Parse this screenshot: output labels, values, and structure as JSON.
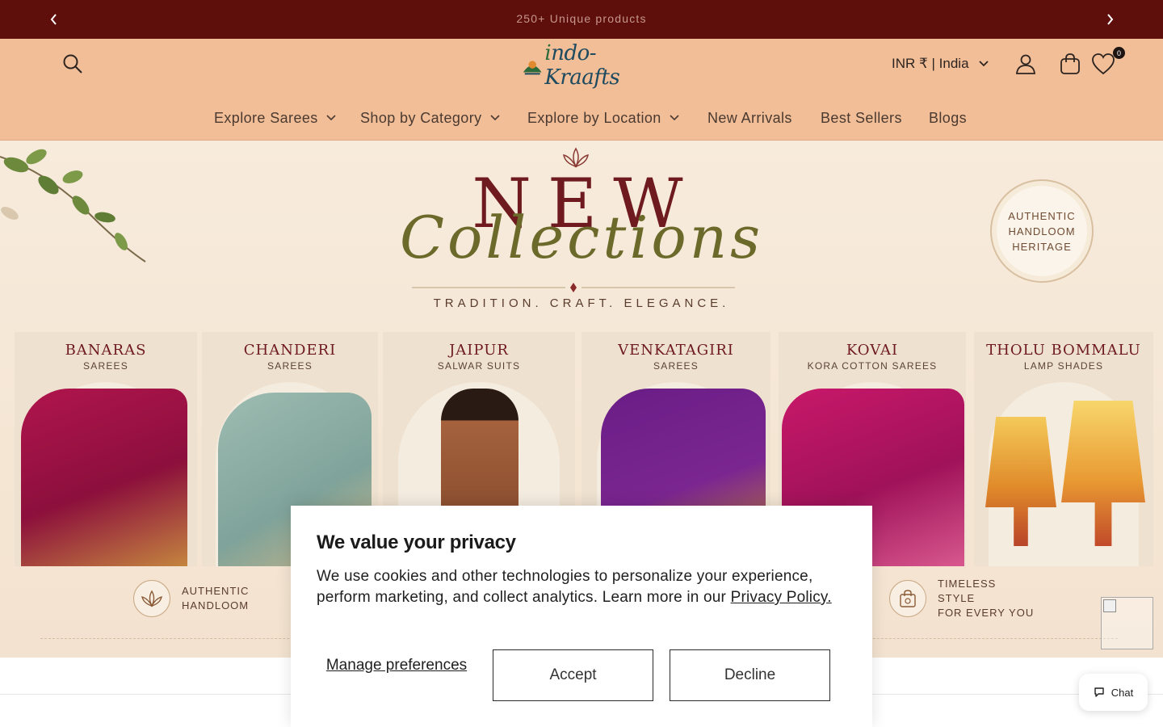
{
  "announcement": {
    "text": "250+ Unique products",
    "prev_icon": "chevron-left-icon",
    "next_icon": "chevron-right-icon"
  },
  "header": {
    "logo_text": "ndo-Kraafts",
    "logo_prefix": "i",
    "currency": "INR ₹ | India",
    "wishlist_count": "0",
    "icons": [
      "search-icon",
      "account-icon",
      "cart-icon",
      "heart-icon"
    ]
  },
  "nav": {
    "items": [
      {
        "label": "Explore Sarees",
        "has_dropdown": true
      },
      {
        "label": "Shop by Category",
        "has_dropdown": true
      },
      {
        "label": "Explore by Location",
        "has_dropdown": true
      },
      {
        "label": "New Arrivals",
        "has_dropdown": false
      },
      {
        "label": "Best Sellers",
        "has_dropdown": false
      },
      {
        "label": "Blogs",
        "has_dropdown": false
      }
    ]
  },
  "hero": {
    "headline": "NEW",
    "script_headline": "Collections",
    "tagline": "TRADITION. CRAFT. ELEGANCE.",
    "seal": "AUTHENTIC HANDLOOM HERITAGE",
    "cards": [
      {
        "title": "BANARAS",
        "subtitle": "SAREES"
      },
      {
        "title": "CHANDERI",
        "subtitle": "SAREES"
      },
      {
        "title": "JAIPUR",
        "subtitle": "SALWAR SUITS"
      },
      {
        "title": "VENKATAGIRI",
        "subtitle": "SAREES"
      },
      {
        "title": "KOVAI",
        "subtitle": "KORA COTTON SAREES"
      },
      {
        "title": "THOLU BOMMALU",
        "subtitle": "LAMP SHADES"
      }
    ],
    "features": [
      {
        "line1": "AUTHENTIC",
        "line2": "HANDLOOM"
      },
      {
        "line1": "TIMELESS STYLE",
        "line2": "FOR EVERY YOU"
      }
    ]
  },
  "cookie": {
    "title": "We value your privacy",
    "body": "We use cookies and other technologies to personalize your experience, perform marketing, and collect analytics. Learn more in our",
    "link": "Privacy Policy.",
    "manage": "Manage preferences",
    "accept": "Accept",
    "decline": "Decline"
  },
  "chat": {
    "label": "Chat"
  },
  "colors": {
    "announcement_bg": "#5e0f0c",
    "header_bg": "#f1be98",
    "hero_bg": "#f5e6d4",
    "brand_maroon": "#6e1a1f"
  }
}
